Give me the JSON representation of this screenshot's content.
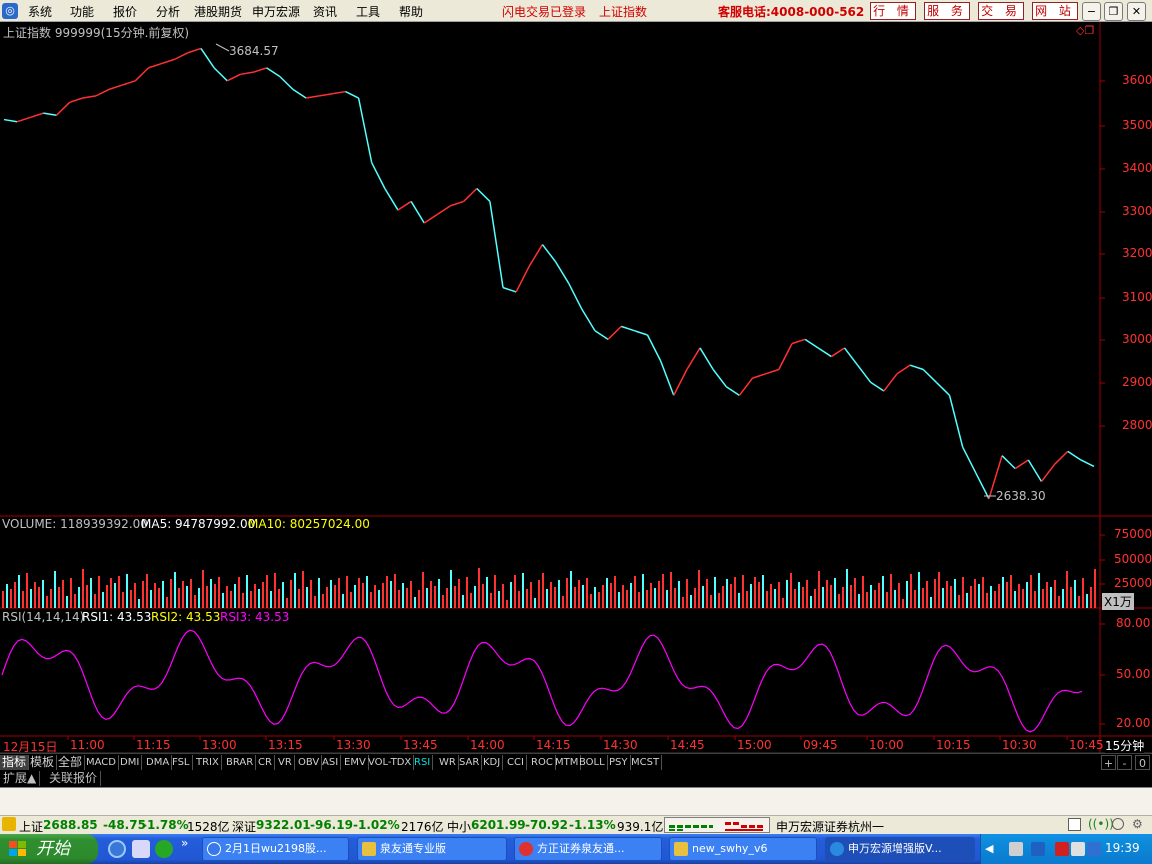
{
  "menubar": {
    "items": [
      "系统",
      "功能",
      "报价",
      "分析",
      "港股期货",
      "申万宏源",
      "资讯",
      "工具",
      "帮助"
    ],
    "status_login": "闪电交易已登录",
    "status_index": "上证指数",
    "hotline": "客服电话:4008-000-562",
    "buttons": [
      "行 情",
      "服 务",
      "交 易",
      "网 站"
    ]
  },
  "price_panel": {
    "title": "上证指数 999999(15分钟.前复权)",
    "high_label": "3684.57",
    "low_label": "2638.30",
    "y_ticks": [
      "3600",
      "3500",
      "3400",
      "3300",
      "3200",
      "3100",
      "3000",
      "2900",
      "2800"
    ]
  },
  "volume_panel": {
    "label_volume": "VOLUME: 118939392.00",
    "label_ma5": "MA5: 94787992.00",
    "label_ma10": "MA10: 80257024.00",
    "y_ticks": [
      "75000",
      "50000",
      "25000"
    ],
    "unit": "X1万"
  },
  "rsi_panel": {
    "label_title": "RSI(14,14,14)",
    "label_rsi1": "RSI1: 43.53",
    "label_rsi2": "RSI2: 43.53",
    "label_rsi3": "RSI3: 43.53",
    "y_ticks": [
      "80.00",
      "50.00",
      "20.00"
    ]
  },
  "time_axis": {
    "labels": [
      "12月15日",
      "11:00",
      "11:15",
      "13:00",
      "13:15",
      "13:30",
      "13:45",
      "14:00",
      "14:15",
      "14:30",
      "14:45",
      "15:00",
      "09:45",
      "10:00",
      "10:15",
      "10:30",
      "10:45"
    ],
    "period": "15分钟"
  },
  "indicator_tabs": [
    "指标",
    "模板",
    "全部",
    "MACD",
    "DMI",
    "DMA",
    "FSL",
    "TRIX",
    "BRAR",
    "CR",
    "VR",
    "OBV",
    "ASI",
    "EMV",
    "VOL-TDX",
    "RSI",
    "WR",
    "SAR",
    "KDJ",
    "CCI",
    "ROC",
    "MTM",
    "BOLL",
    "PSY",
    "MCST"
  ],
  "active_indicator": "RSI",
  "tab_controls": [
    "+",
    "-",
    "0"
  ],
  "ext_tabs": [
    "扩展▲",
    "关联报价"
  ],
  "statusbar": {
    "sh_name": "上证",
    "sh_value": "2688.85",
    "sh_change": "-48.75",
    "sh_pct": "-1.78%",
    "sh_amount": "1528亿",
    "sz_name": "深证",
    "sz_value": "9322.01",
    "sz_change": "-96.19",
    "sz_pct": "-1.02%",
    "sz_amount": "2176亿",
    "zx_name": "中小",
    "zx_value": "6201.99",
    "zx_change": "-70.92",
    "zx_pct": "-1.13%",
    "zx_amount": "939.1亿",
    "broker": "申万宏源证券杭州一"
  },
  "taskbar": {
    "start_label": "开始",
    "tasks": [
      "2月1日wu2198股...",
      "泉友通专业版",
      "方正证券泉友通...",
      "new_swhy_v6",
      "申万宏源增强版V..."
    ],
    "clock": "19:39"
  },
  "colors": {
    "up": "#ff3232",
    "down": "#54ffff",
    "ma5": "#ffffff",
    "ma10": "#ffff00",
    "rsi": "#ff00ff",
    "axis": "#a00000"
  }
}
